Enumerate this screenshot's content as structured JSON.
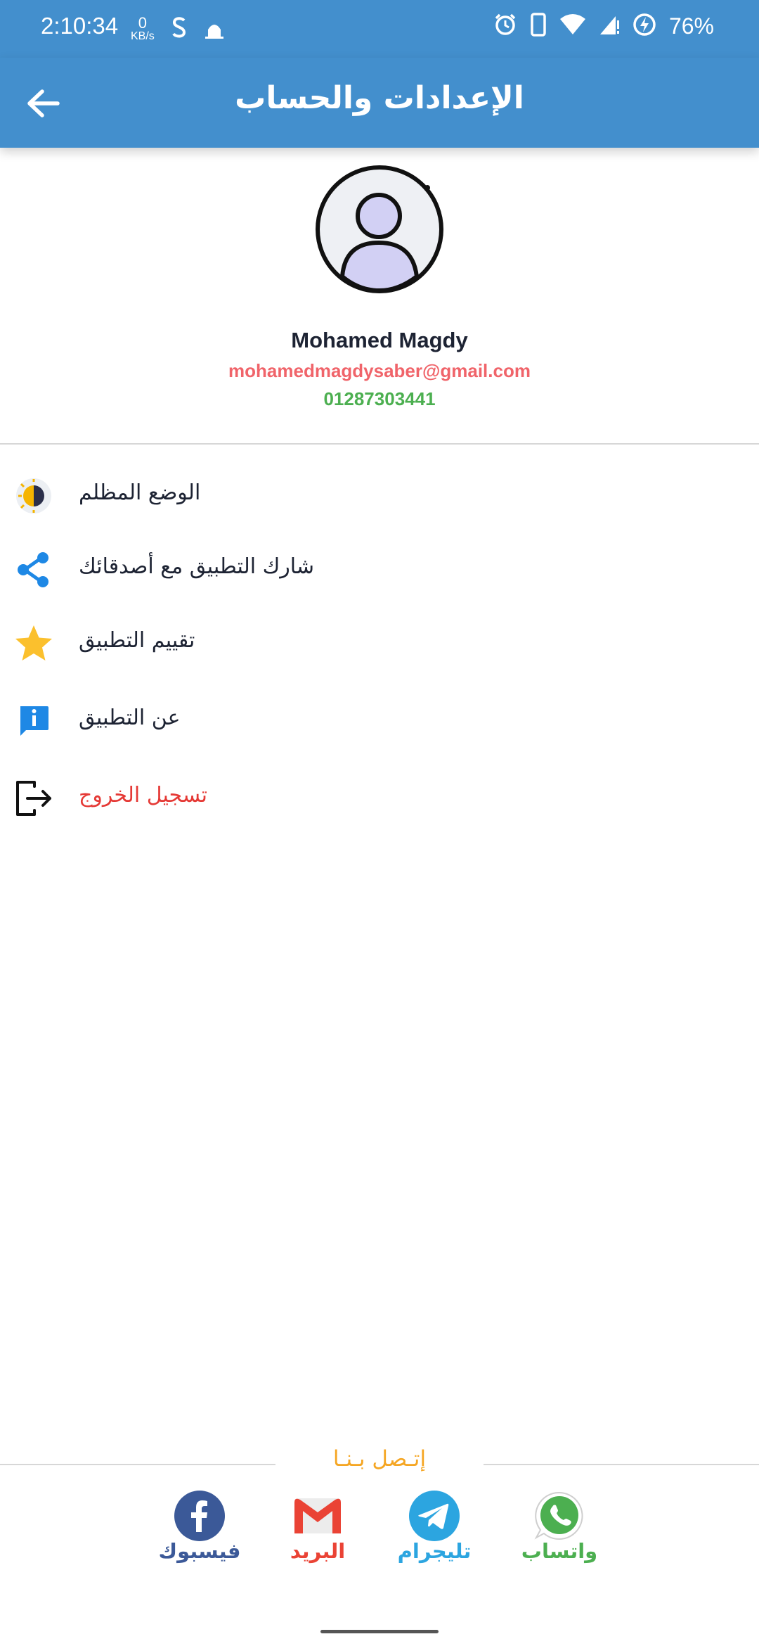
{
  "status_bar": {
    "time": "2:10:34",
    "net_speed_value": "0",
    "net_speed_unit": "KB/s",
    "battery": "76%"
  },
  "app_bar": {
    "title": "الإعدادات والحساب"
  },
  "profile": {
    "name": "Mohamed Magdy",
    "email": "mohamedmagdysaber@gmail.com",
    "phone": "01287303441"
  },
  "menu": {
    "dark_mode": "الوضع المظلم",
    "share": "شارك التطبيق مع أصدقائك",
    "rate": "تقييم التطبيق",
    "about": "عن التطبيق",
    "logout": "تسجيل الخروج"
  },
  "contact": {
    "title": "إتـصل بـنـا",
    "facebook": "فيسبوك",
    "mail": "البريد",
    "telegram": "تليجرام",
    "whatsapp": "واتساب"
  },
  "colors": {
    "primary": "#438fcd",
    "email": "#f0646a",
    "phone": "#4caf50",
    "logout": "#e53935",
    "contact_title": "#f5a623",
    "facebook": "#3b5998",
    "mail": "#ea4335",
    "telegram": "#2ca5e0",
    "whatsapp": "#4caf50"
  },
  "icons": {
    "dark_mode": "day-night-icon",
    "share": "share-icon",
    "rate": "star-icon",
    "about": "info-icon",
    "logout": "logout-icon"
  }
}
